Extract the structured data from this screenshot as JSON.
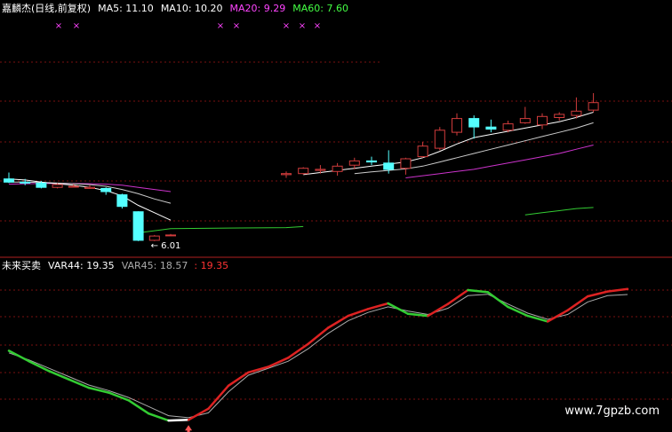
{
  "header_main": {
    "stock": "嘉麟杰(日线,前复权)",
    "ma5": "MA5: 11.10",
    "ma10": "MA10: 10.20",
    "ma20": "MA20: 9.29",
    "ma60": "MA60: 7.60"
  },
  "header_indicator": {
    "name": "未来买卖",
    "var44": "VAR44: 19.35",
    "var45": "VAR45: 18.57",
    "extra": ": 19.35"
  },
  "colors": {
    "background": "#000000",
    "up_candle": "#d23c3c",
    "down_candle": "#54ffff",
    "ma5": "#ffffff",
    "ma10": "#ffffff",
    "ma20": "#cc33cc",
    "ma60": "#33cc33",
    "grid": "#7a1010",
    "var_up": "#dd2222",
    "var_down": "#33cc33",
    "var_flat": "#ffffff",
    "var45": "#aaaaaa",
    "header_ma5": "#ffffff",
    "header_ma20": "#ff44ff",
    "header_ma60": "#44ff44",
    "header_var45": "#aaaaaa",
    "header_extra": "#ff3333",
    "marker": "#ff44ff"
  },
  "low_price_label": "6.01",
  "watermark": "www.7gpzb.com",
  "chart_data": [
    {
      "type": "candlestick",
      "title": "嘉麟杰(日线,前复权)",
      "note": "Daily candles with MA lines (prices approximated from chart)",
      "ylim": [
        5.5,
        13.0
      ],
      "candles": [
        {
          "o": 8.95,
          "h": 9.25,
          "l": 8.75,
          "c": 8.8
        },
        {
          "o": 8.8,
          "h": 8.95,
          "l": 8.65,
          "c": 8.75
        },
        {
          "o": 8.75,
          "h": 8.85,
          "l": 8.5,
          "c": 8.55
        },
        {
          "o": 8.55,
          "h": 8.75,
          "l": 8.5,
          "c": 8.68
        },
        {
          "o": 8.6,
          "h": 8.7,
          "l": 8.55,
          "c": 8.6
        },
        {
          "o": 8.5,
          "h": 8.65,
          "l": 8.48,
          "c": 8.55
        },
        {
          "o": 8.5,
          "h": 8.55,
          "l": 8.2,
          "c": 8.35
        },
        {
          "o": 8.2,
          "h": 8.25,
          "l": 7.55,
          "c": 7.65
        },
        {
          "o": 7.4,
          "h": 7.42,
          "l": 6.01,
          "c": 6.05
        },
        {
          "o": 6.05,
          "h": 6.3,
          "l": 6.01,
          "c": 6.25
        },
        {
          "o": 6.3,
          "h": 6.35,
          "l": 6.25,
          "c": 6.3
        },
        {
          "o": 9.15,
          "h": 9.3,
          "l": 9.0,
          "c": 9.2
        },
        {
          "o": 9.2,
          "h": 9.5,
          "l": 9.15,
          "c": 9.45
        },
        {
          "o": 9.35,
          "h": 9.6,
          "l": 9.2,
          "c": 9.4
        },
        {
          "o": 9.3,
          "h": 9.7,
          "l": 9.1,
          "c": 9.55
        },
        {
          "o": 9.6,
          "h": 9.95,
          "l": 9.4,
          "c": 9.8
        },
        {
          "o": 9.8,
          "h": 10.0,
          "l": 9.6,
          "c": 9.75
        },
        {
          "o": 9.7,
          "h": 10.3,
          "l": 9.2,
          "c": 9.4
        },
        {
          "o": 9.45,
          "h": 9.95,
          "l": 9.15,
          "c": 9.9
        },
        {
          "o": 10.0,
          "h": 10.7,
          "l": 9.95,
          "c": 10.5
        },
        {
          "o": 10.4,
          "h": 11.4,
          "l": 10.3,
          "c": 11.25
        },
        {
          "o": 11.15,
          "h": 12.05,
          "l": 11.0,
          "c": 11.8
        },
        {
          "o": 11.8,
          "h": 11.95,
          "l": 10.85,
          "c": 11.4
        },
        {
          "o": 11.4,
          "h": 11.75,
          "l": 11.15,
          "c": 11.3
        },
        {
          "o": 11.25,
          "h": 11.7,
          "l": 11.15,
          "c": 11.55
        },
        {
          "o": 11.6,
          "h": 12.35,
          "l": 11.55,
          "c": 11.8
        },
        {
          "o": 11.5,
          "h": 12.05,
          "l": 11.3,
          "c": 11.9
        },
        {
          "o": 11.85,
          "h": 12.1,
          "l": 11.7,
          "c": 12.0
        },
        {
          "o": 11.95,
          "h": 12.8,
          "l": 11.8,
          "c": 12.15
        },
        {
          "o": 12.2,
          "h": 13.0,
          "l": 12.1,
          "c": 12.55
        }
      ],
      "ma5": [
        8.95,
        8.9,
        8.8,
        8.72,
        8.65,
        8.55,
        8.4,
        8.15,
        7.7,
        7.35,
        7.0,
        null,
        9.15,
        9.25,
        9.35,
        9.45,
        9.55,
        9.65,
        9.75,
        9.95,
        10.25,
        10.6,
        10.9,
        11.05,
        11.2,
        11.35,
        11.5,
        11.65,
        11.85,
        12.1
      ],
      "ma10": [
        8.8,
        8.8,
        8.78,
        8.75,
        8.72,
        8.68,
        8.6,
        8.45,
        8.25,
        8.0,
        7.8,
        null,
        null,
        null,
        null,
        9.2,
        9.28,
        9.35,
        9.42,
        9.55,
        9.75,
        9.95,
        10.15,
        10.35,
        10.55,
        10.75,
        10.95,
        11.15,
        11.35,
        11.6
      ],
      "ma20": [
        8.7,
        8.72,
        8.73,
        8.74,
        8.73,
        8.72,
        8.7,
        8.65,
        8.55,
        8.45,
        8.35,
        null,
        null,
        null,
        null,
        null,
        null,
        null,
        9.0,
        9.1,
        9.2,
        9.3,
        9.4,
        9.55,
        9.7,
        9.85,
        10.0,
        10.15,
        10.35,
        10.55
      ],
      "ma60": [
        null,
        null,
        null,
        null,
        null,
        null,
        null,
        null,
        6.4,
        6.5,
        6.6,
        6.65,
        6.7,
        null,
        null,
        null,
        null,
        null,
        null,
        null,
        null,
        null,
        null,
        null,
        null,
        7.25,
        7.35,
        7.45,
        7.55,
        7.6
      ]
    },
    {
      "type": "line",
      "title": "未来买卖",
      "ylim": [
        0,
        22
      ],
      "series": [
        {
          "name": "VAR44",
          "values": [
            10.5,
            9.0,
            7.6,
            6.4,
            5.2,
            4.5,
            3.4,
            1.5,
            0.5,
            0.6,
            2.2,
            5.5,
            7.4,
            8.2,
            9.5,
            11.5,
            13.8,
            15.5,
            16.5,
            17.3,
            15.8,
            15.5,
            17.2,
            19.2,
            18.9,
            16.8,
            15.5,
            14.7,
            16.3,
            18.3,
            19.0,
            19.35
          ]
        },
        {
          "name": "VAR45",
          "values": [
            10.2,
            9.2,
            8.0,
            6.8,
            5.6,
            4.8,
            3.8,
            2.5,
            1.2,
            0.9,
            1.6,
            4.6,
            7.0,
            8.0,
            9.0,
            10.8,
            13.0,
            14.8,
            16.0,
            16.8,
            16.2,
            15.7,
            16.6,
            18.4,
            18.6,
            17.2,
            15.9,
            15.0,
            15.7,
            17.5,
            18.4,
            18.57
          ]
        }
      ]
    }
  ]
}
